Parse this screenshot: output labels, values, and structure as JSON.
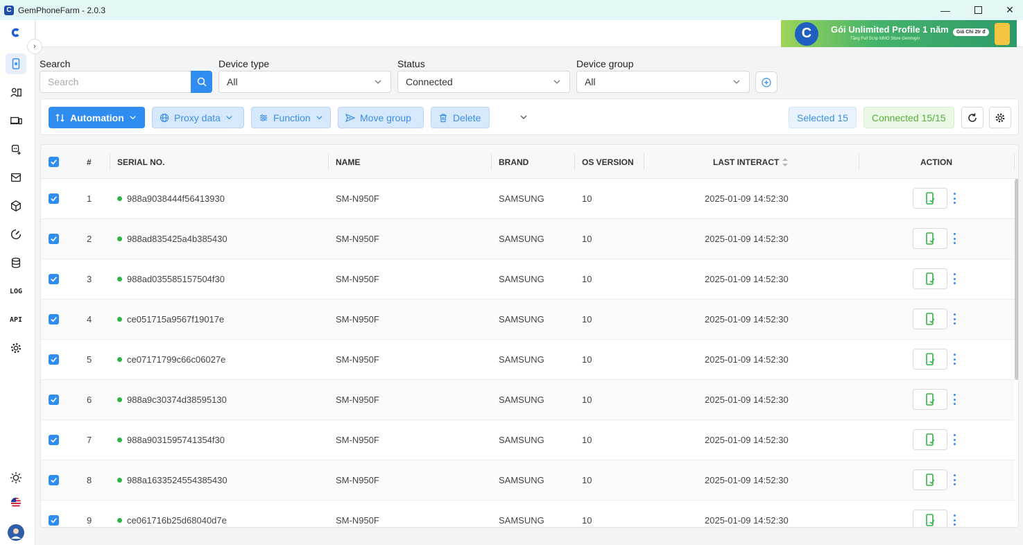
{
  "window": {
    "title": "GemPhoneFarm - 2.0.3"
  },
  "banner": {
    "title": "Gói Unlimited Profile 1 năm",
    "subtitle": "Tặng Full Scrip MMO Store Gemlogin",
    "badge": "Giá Chỉ 2tr đ"
  },
  "sidebar": {
    "log_label": "LOG",
    "api_label": "API"
  },
  "filters": {
    "search_label": "Search",
    "search_placeholder": "Search",
    "device_type_label": "Device type",
    "device_type_value": "All",
    "status_label": "Status",
    "status_value": "Connected",
    "device_group_label": "Device group",
    "device_group_value": "All"
  },
  "toolbar": {
    "automation": "Automation",
    "proxy_data": "Proxy data",
    "function": "Function",
    "move_group": "Move group",
    "delete": "Delete",
    "selected": "Selected 15",
    "connected": "Connected 15/15"
  },
  "table": {
    "headers": {
      "num": "#",
      "serial": "SERIAL NO.",
      "name": "NAME",
      "brand": "BRAND",
      "os": "OS VERSION",
      "last": "LAST INTERACT",
      "action": "ACTION"
    },
    "rows": [
      {
        "num": "1",
        "serial": "988a9038444f56413930",
        "name": "SM-N950F",
        "brand": "SAMSUNG",
        "os": "10",
        "last": "2025-01-09 14:52:30"
      },
      {
        "num": "2",
        "serial": "988ad835425a4b385430",
        "name": "SM-N950F",
        "brand": "SAMSUNG",
        "os": "10",
        "last": "2025-01-09 14:52:30"
      },
      {
        "num": "3",
        "serial": "988ad035585157504f30",
        "name": "SM-N950F",
        "brand": "SAMSUNG",
        "os": "10",
        "last": "2025-01-09 14:52:30"
      },
      {
        "num": "4",
        "serial": "ce051715a9567f19017e",
        "name": "SM-N950F",
        "brand": "SAMSUNG",
        "os": "10",
        "last": "2025-01-09 14:52:30"
      },
      {
        "num": "5",
        "serial": "ce07171799c66c06027e",
        "name": "SM-N950F",
        "brand": "SAMSUNG",
        "os": "10",
        "last": "2025-01-09 14:52:30"
      },
      {
        "num": "6",
        "serial": "988a9c30374d38595130",
        "name": "SM-N950F",
        "brand": "SAMSUNG",
        "os": "10",
        "last": "2025-01-09 14:52:30"
      },
      {
        "num": "7",
        "serial": "988a9031595741354f30",
        "name": "SM-N950F",
        "brand": "SAMSUNG",
        "os": "10",
        "last": "2025-01-09 14:52:30"
      },
      {
        "num": "8",
        "serial": "988a1633524554385430",
        "name": "SM-N950F",
        "brand": "SAMSUNG",
        "os": "10",
        "last": "2025-01-09 14:52:30"
      },
      {
        "num": "9",
        "serial": "ce061716b25d68040d7e",
        "name": "SM-N950F",
        "brand": "SAMSUNG",
        "os": "10",
        "last": "2025-01-09 14:52:30"
      }
    ]
  },
  "colors": {
    "accent": "#2f8cf0",
    "status_online": "#2fb344",
    "titlebar": "#e4f7f7"
  }
}
